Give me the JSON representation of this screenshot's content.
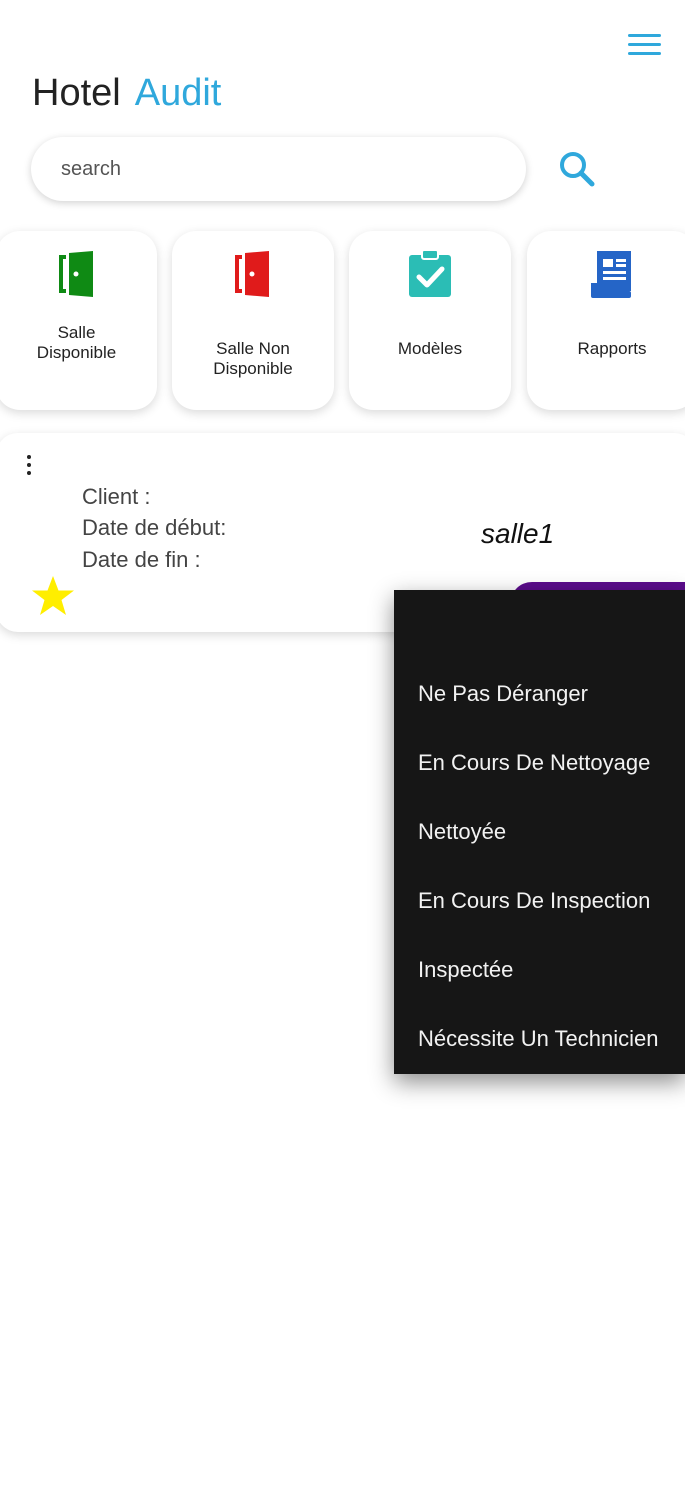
{
  "app": {
    "title_part1": "Hotel",
    "title_part2": "Audit"
  },
  "search": {
    "placeholder": "search"
  },
  "categories": [
    {
      "label": "Salle Disponible",
      "icon": "door-open-green-icon",
      "color": "#0f8a14"
    },
    {
      "label": "Salle Non Disponible",
      "icon": "door-closed-red-icon",
      "color": "#e01b1b"
    },
    {
      "label": "Modèles",
      "icon": "clipboard-check-icon",
      "color": "#2bbdb5"
    },
    {
      "label": "Rapports",
      "icon": "report-icon",
      "color": "#2565c7"
    }
  ],
  "room_card": {
    "client_label": "Client :",
    "start_label": "Date de début:",
    "end_label": "Date de fin :",
    "room_name": "salle1",
    "star_color": "#ffee00",
    "status_color": "#5b0c8c"
  },
  "status_menu": {
    "items": [
      "Ne Pas Déranger",
      "En Cours De Nettoyage",
      "Nettoyée",
      "En Cours De Inspection",
      "Inspectée",
      "Nécessite Un Technicien"
    ]
  },
  "colors": {
    "accent": "#2fa8dc",
    "menu_bg": "#161616"
  }
}
